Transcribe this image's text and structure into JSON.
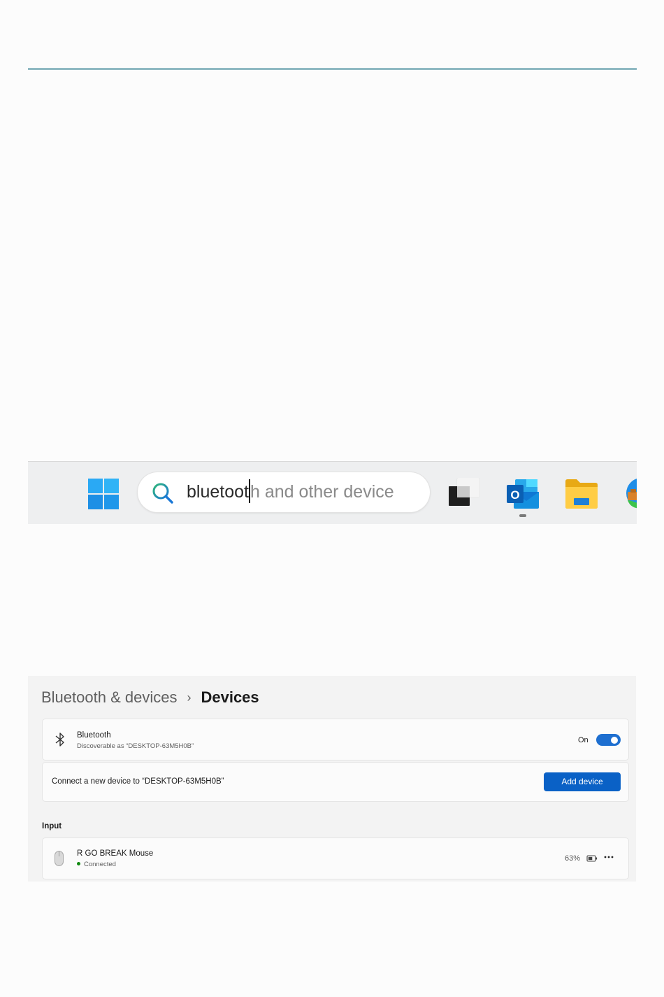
{
  "taskbar": {
    "search": {
      "typed_text": "bluetoot",
      "suggestion_text": "h and other device"
    },
    "icons": {
      "start": "windows-start-icon",
      "search": "search-icon",
      "task_view": "task-view-icon",
      "outlook": "outlook-icon",
      "explorer": "file-explorer-icon",
      "edge": "edge-icon"
    },
    "outlook_letter": "O"
  },
  "settings": {
    "breadcrumb": {
      "parent": "Bluetooth & devices",
      "separator": "›",
      "current": "Devices"
    },
    "bluetooth": {
      "title": "Bluetooth",
      "subtitle": "Discoverable as “DESKTOP-63M5H0B”",
      "toggle_label": "On",
      "toggle_on": true,
      "icon": "bluetooth-icon"
    },
    "connect": {
      "text": "Connect a new device to “DESKTOP-63M5H0B”",
      "button_label": "Add device"
    },
    "input_section": {
      "label": "Input",
      "device": {
        "name": "R GO BREAK Mouse",
        "status": "Connected",
        "battery": "63%",
        "icon": "mouse-icon"
      }
    }
  },
  "colors": {
    "accent": "#0a61c6",
    "toggle_on": "#1e6fd0",
    "connected_dot": "#128a12",
    "top_rule": "#8fb9c2"
  }
}
